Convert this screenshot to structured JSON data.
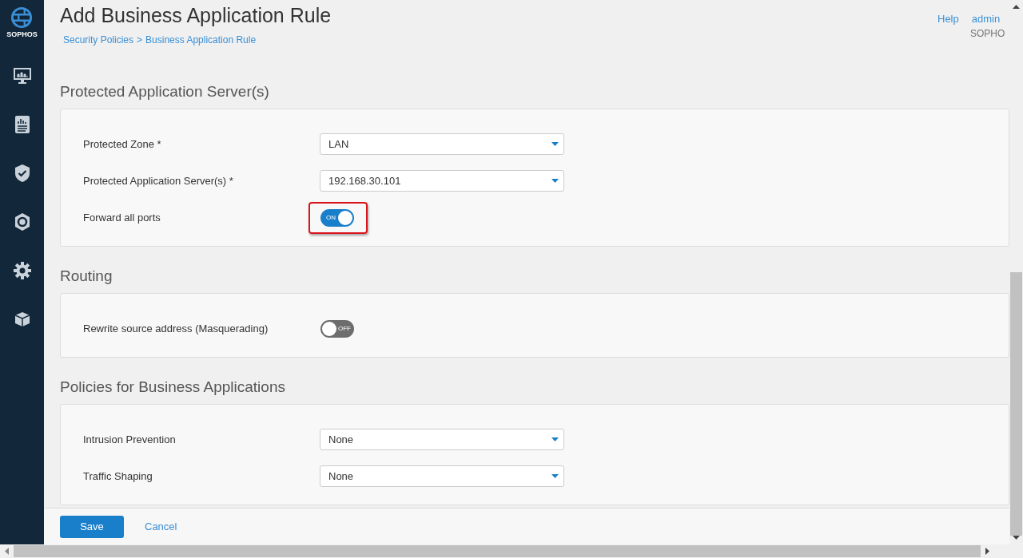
{
  "sidebar": {
    "logo_text": "SOPHOS",
    "items": [
      {
        "kind": "monitor"
      },
      {
        "kind": "report"
      },
      {
        "kind": "shield"
      },
      {
        "kind": "protect"
      },
      {
        "kind": "gear"
      },
      {
        "kind": "box"
      }
    ]
  },
  "header": {
    "title": "Add Business Application Rule",
    "breadcrumb": [
      "Security Policies",
      "Business Application Rule"
    ],
    "separator": ">",
    "help": "Help",
    "user": "admin",
    "appliance": "SOPHO"
  },
  "sections": [
    {
      "title": "Protected Application Server(s)",
      "rows": [
        {
          "kind": "select",
          "label": "Protected Zone *",
          "value": "LAN"
        },
        {
          "kind": "select",
          "label": "Protected Application Server(s) *",
          "value": "192.168.30.101"
        },
        {
          "kind": "toggle",
          "label": "Forward all ports",
          "on": true,
          "on_text": "ON",
          "highlighted": true
        }
      ]
    },
    {
      "title": "Routing",
      "rows": [
        {
          "kind": "toggle",
          "label": "Rewrite source address (Masquerading)",
          "on": false,
          "off_text": "OFF",
          "highlighted": false
        }
      ]
    },
    {
      "title": "Policies for Business Applications",
      "rows": [
        {
          "kind": "select",
          "label": "Intrusion Prevention",
          "value": "None"
        },
        {
          "kind": "select",
          "label": "Traffic Shaping",
          "value": "None"
        }
      ]
    }
  ],
  "footer": {
    "save": "Save",
    "cancel": "Cancel"
  }
}
